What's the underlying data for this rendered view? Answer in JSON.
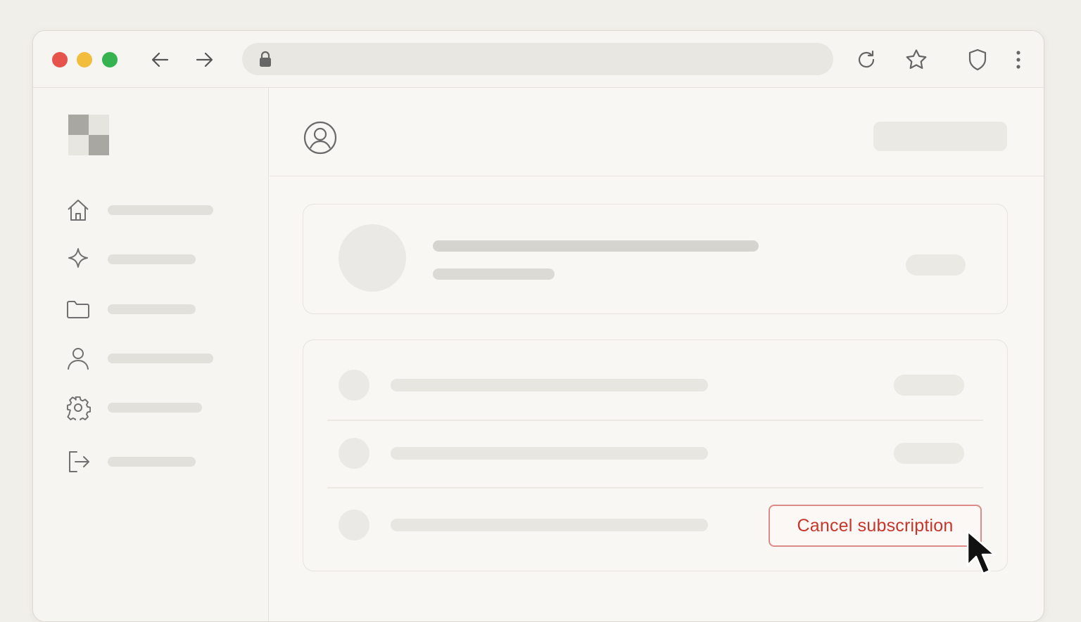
{
  "browser": {
    "url_value": "",
    "icons": [
      "back-arrow-icon",
      "forward-arrow-icon",
      "lock-icon",
      "reload-icon",
      "star-icon",
      "shield-icon",
      "more-vertical-icon"
    ]
  },
  "sidebar": {
    "items": [
      {
        "icon": "home-icon"
      },
      {
        "icon": "sparkle-icon"
      },
      {
        "icon": "folder-icon"
      },
      {
        "icon": "user-icon"
      },
      {
        "icon": "gear-icon"
      },
      {
        "icon": "logout-icon"
      }
    ]
  },
  "main": {
    "header": {
      "icon": "profile-icon"
    },
    "subscription": {
      "cancel_label": "Cancel subscription"
    }
  },
  "colors": {
    "accent_danger": "#c8352b",
    "danger_border": "#dd8b86",
    "background": "#f1efea",
    "window": "#f8f7f3"
  }
}
